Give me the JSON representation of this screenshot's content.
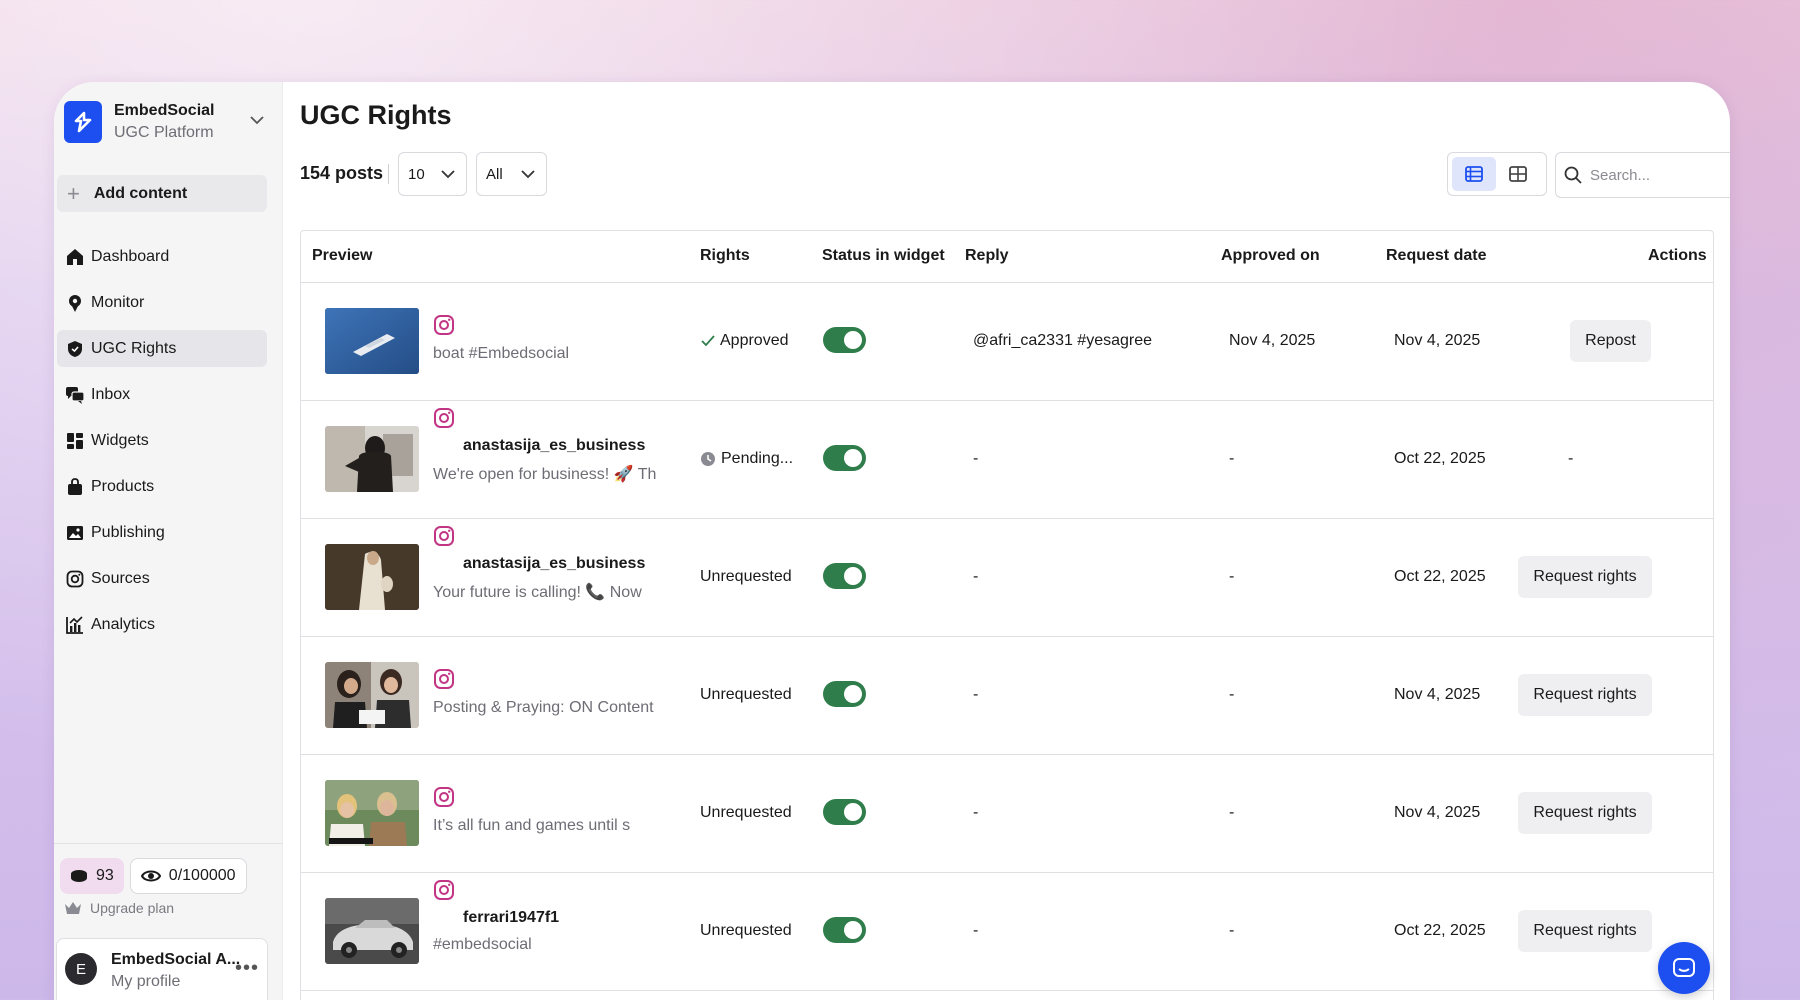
{
  "brand": {
    "name": "EmbedSocial",
    "subtitle": "UGC Platform",
    "logo_icon": "embedsocial-logo-icon",
    "accent": "#1d4ff0"
  },
  "sidebar": {
    "add_content": "Add content",
    "items": [
      {
        "label": "Dashboard",
        "icon": "home-icon",
        "active": false
      },
      {
        "label": "Monitor",
        "icon": "monitor-icon",
        "active": false
      },
      {
        "label": "UGC Rights",
        "icon": "shield-icon",
        "active": true
      },
      {
        "label": "Inbox",
        "icon": "chat-icon",
        "active": false
      },
      {
        "label": "Widgets",
        "icon": "widgets-icon",
        "active": false
      },
      {
        "label": "Products",
        "icon": "bag-icon",
        "active": false
      },
      {
        "label": "Publishing",
        "icon": "image-icon",
        "active": false
      },
      {
        "label": "Sources",
        "icon": "instagram-icon",
        "active": false
      },
      {
        "label": "Analytics",
        "icon": "analytics-icon",
        "active": false
      }
    ],
    "credits": "93",
    "views": "0/100000",
    "upgrade": "Upgrade plan",
    "profile": {
      "initial": "E",
      "name": "EmbedSocial A...",
      "sub": "My profile"
    }
  },
  "page": {
    "title": "UGC Rights"
  },
  "toolbar": {
    "post_count": "154 posts",
    "per_page": "10",
    "filter": "All",
    "search_placeholder": "Search..."
  },
  "table": {
    "headers": {
      "preview": "Preview",
      "rights": "Rights",
      "status": "Status in widget",
      "reply": "Reply",
      "approved": "Approved on",
      "request": "Request date",
      "actions": "Actions"
    },
    "rows": [
      {
        "author": "",
        "caption": "boat #Embedsocial",
        "rights": "Approved",
        "rights_icon": "check-icon",
        "widget_on": true,
        "reply": "@afri_ca2331 #yesagree",
        "approved_on": "Nov 4, 2025",
        "request_date": "Nov 4, 2025",
        "action": "Repost"
      },
      {
        "author": "anastasija_es_business",
        "caption": "We're open for business! 🚀 Th",
        "rights": "Pending...",
        "rights_icon": "clock-icon",
        "widget_on": true,
        "reply": "-",
        "approved_on": "-",
        "request_date": "Oct 22, 2025",
        "action": "-"
      },
      {
        "author": "anastasija_es_business",
        "caption": "Your future is calling! 📞 Now",
        "rights": "Unrequested",
        "rights_icon": "",
        "widget_on": true,
        "reply": "-",
        "approved_on": "-",
        "request_date": "Oct 22, 2025",
        "action": "Request rights"
      },
      {
        "author": "",
        "caption": "Posting & Praying: ON Content",
        "rights": "Unrequested",
        "rights_icon": "",
        "widget_on": true,
        "reply": "-",
        "approved_on": "-",
        "request_date": "Nov 4, 2025",
        "action": "Request rights"
      },
      {
        "author": "",
        "caption": "It’s all fun and games until s",
        "rights": "Unrequested",
        "rights_icon": "",
        "widget_on": true,
        "reply": "-",
        "approved_on": "-",
        "request_date": "Nov 4, 2025",
        "action": "Request rights"
      },
      {
        "author": "ferrari1947f1",
        "caption": "#embedsocial",
        "rights": "Unrequested",
        "rights_icon": "",
        "widget_on": true,
        "reply": "-",
        "approved_on": "-",
        "request_date": "Oct 22, 2025",
        "action": "Request rights"
      }
    ]
  },
  "colors": {
    "toggle_on": "#2e7d4a",
    "active_nav": "#e6e6ea",
    "instagram": "#c13584"
  }
}
